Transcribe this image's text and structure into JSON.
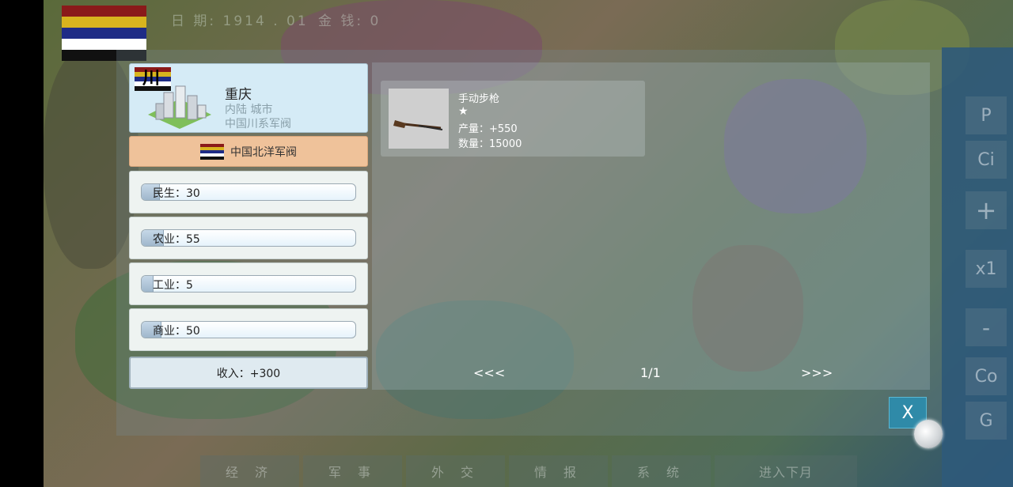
{
  "hud": {
    "date_label": "日 期:",
    "date_value": "1914 . 01",
    "money_label": "金 钱:",
    "money_value": "0"
  },
  "player_flag_colors": [
    "#8a1a1a",
    "#d8b41e",
    "#1f2c86",
    "#ffffff",
    "#111111"
  ],
  "city": {
    "name": "重庆",
    "location_type": "内陆 城市",
    "faction": "中国川系军阀",
    "badge_text": "川"
  },
  "owner": {
    "name": "中国北洋军阀"
  },
  "stats": [
    {
      "label": "民生：30",
      "value": 30,
      "fill_fraction": 0.08
    },
    {
      "label": "农业：55",
      "value": 55,
      "fill_fraction": 0.1
    },
    {
      "label": "工业：5",
      "value": 5,
      "fill_fraction": 0.05
    },
    {
      "label": "商业：50",
      "value": 50,
      "fill_fraction": 0.09
    }
  ],
  "income": "收入：+300",
  "product": {
    "name": "手动步枪",
    "stars": "★",
    "production": "产量：+550",
    "quantity": "数量：15000"
  },
  "pager": {
    "prev": "<<<",
    "page": "1/1",
    "next": ">>>"
  },
  "close_label": "X",
  "side_controls": [
    "P",
    "Ci",
    "+",
    "x1",
    "-",
    "Co",
    "G"
  ],
  "bottom_tabs": [
    "经 济",
    "军 事",
    "外 交",
    "情 报",
    "系 统",
    "进入下月"
  ]
}
